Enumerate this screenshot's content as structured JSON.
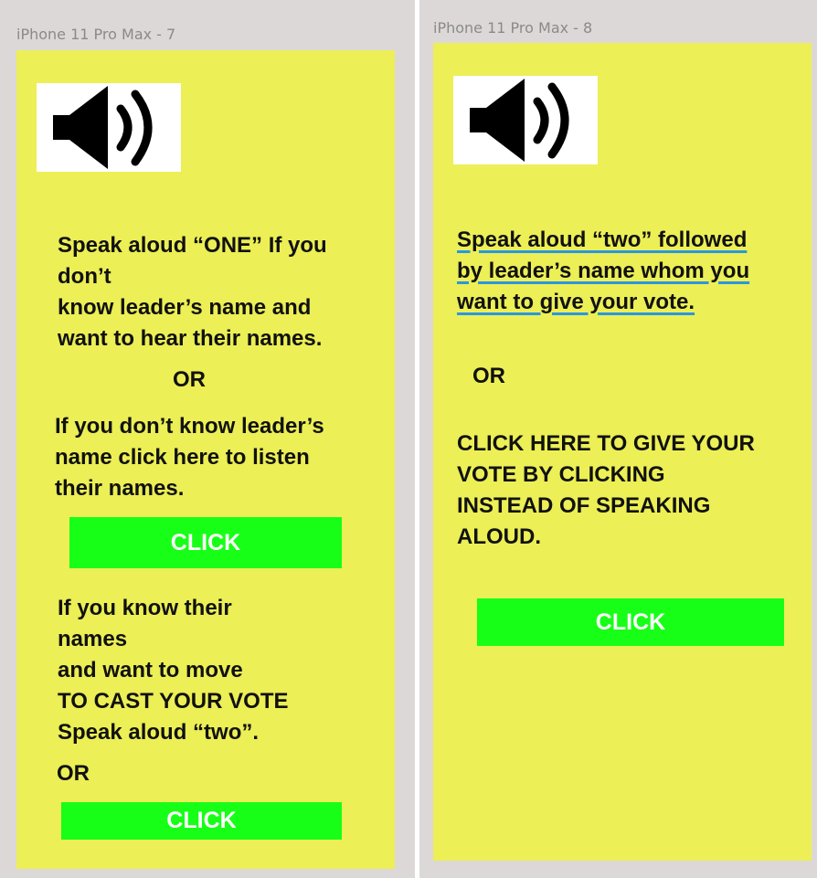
{
  "frames": [
    {
      "label": "iPhone 11 Pro Max - 7",
      "speaker_icon": "speaker-volume-icon",
      "text1": "Speak aloud “ONE” If you\ndon’t\nknow leader’s name and\nwant to hear their names.",
      "or1": "OR",
      "text2": "If you don’t know leader’s\nname click here to listen\ntheir names.",
      "button1": "CLICK",
      "text3": "If you know their\nnames\nand want to move\nTO CAST YOUR VOTE\nSpeak aloud “two”.",
      "or2": "OR",
      "button2": "CLICK"
    },
    {
      "label": "iPhone 11 Pro Max - 8",
      "speaker_icon": "speaker-volume-icon",
      "text1": "Speak aloud “two” followed\nby leader’s name whom you\nwant to give your vote.",
      "or1": "OR",
      "text2": "CLICK HERE TO GIVE YOUR\nVOTE BY CLICKING\n INSTEAD OF SPEAKING\nALOUD.",
      "button1": "CLICK"
    }
  ],
  "colors": {
    "artboard": "#ecef55",
    "button": "#17ff17",
    "button_text": "#ffffff",
    "canvas": "#ddd8d8",
    "spellcheck_underline": "#2a97e0"
  }
}
